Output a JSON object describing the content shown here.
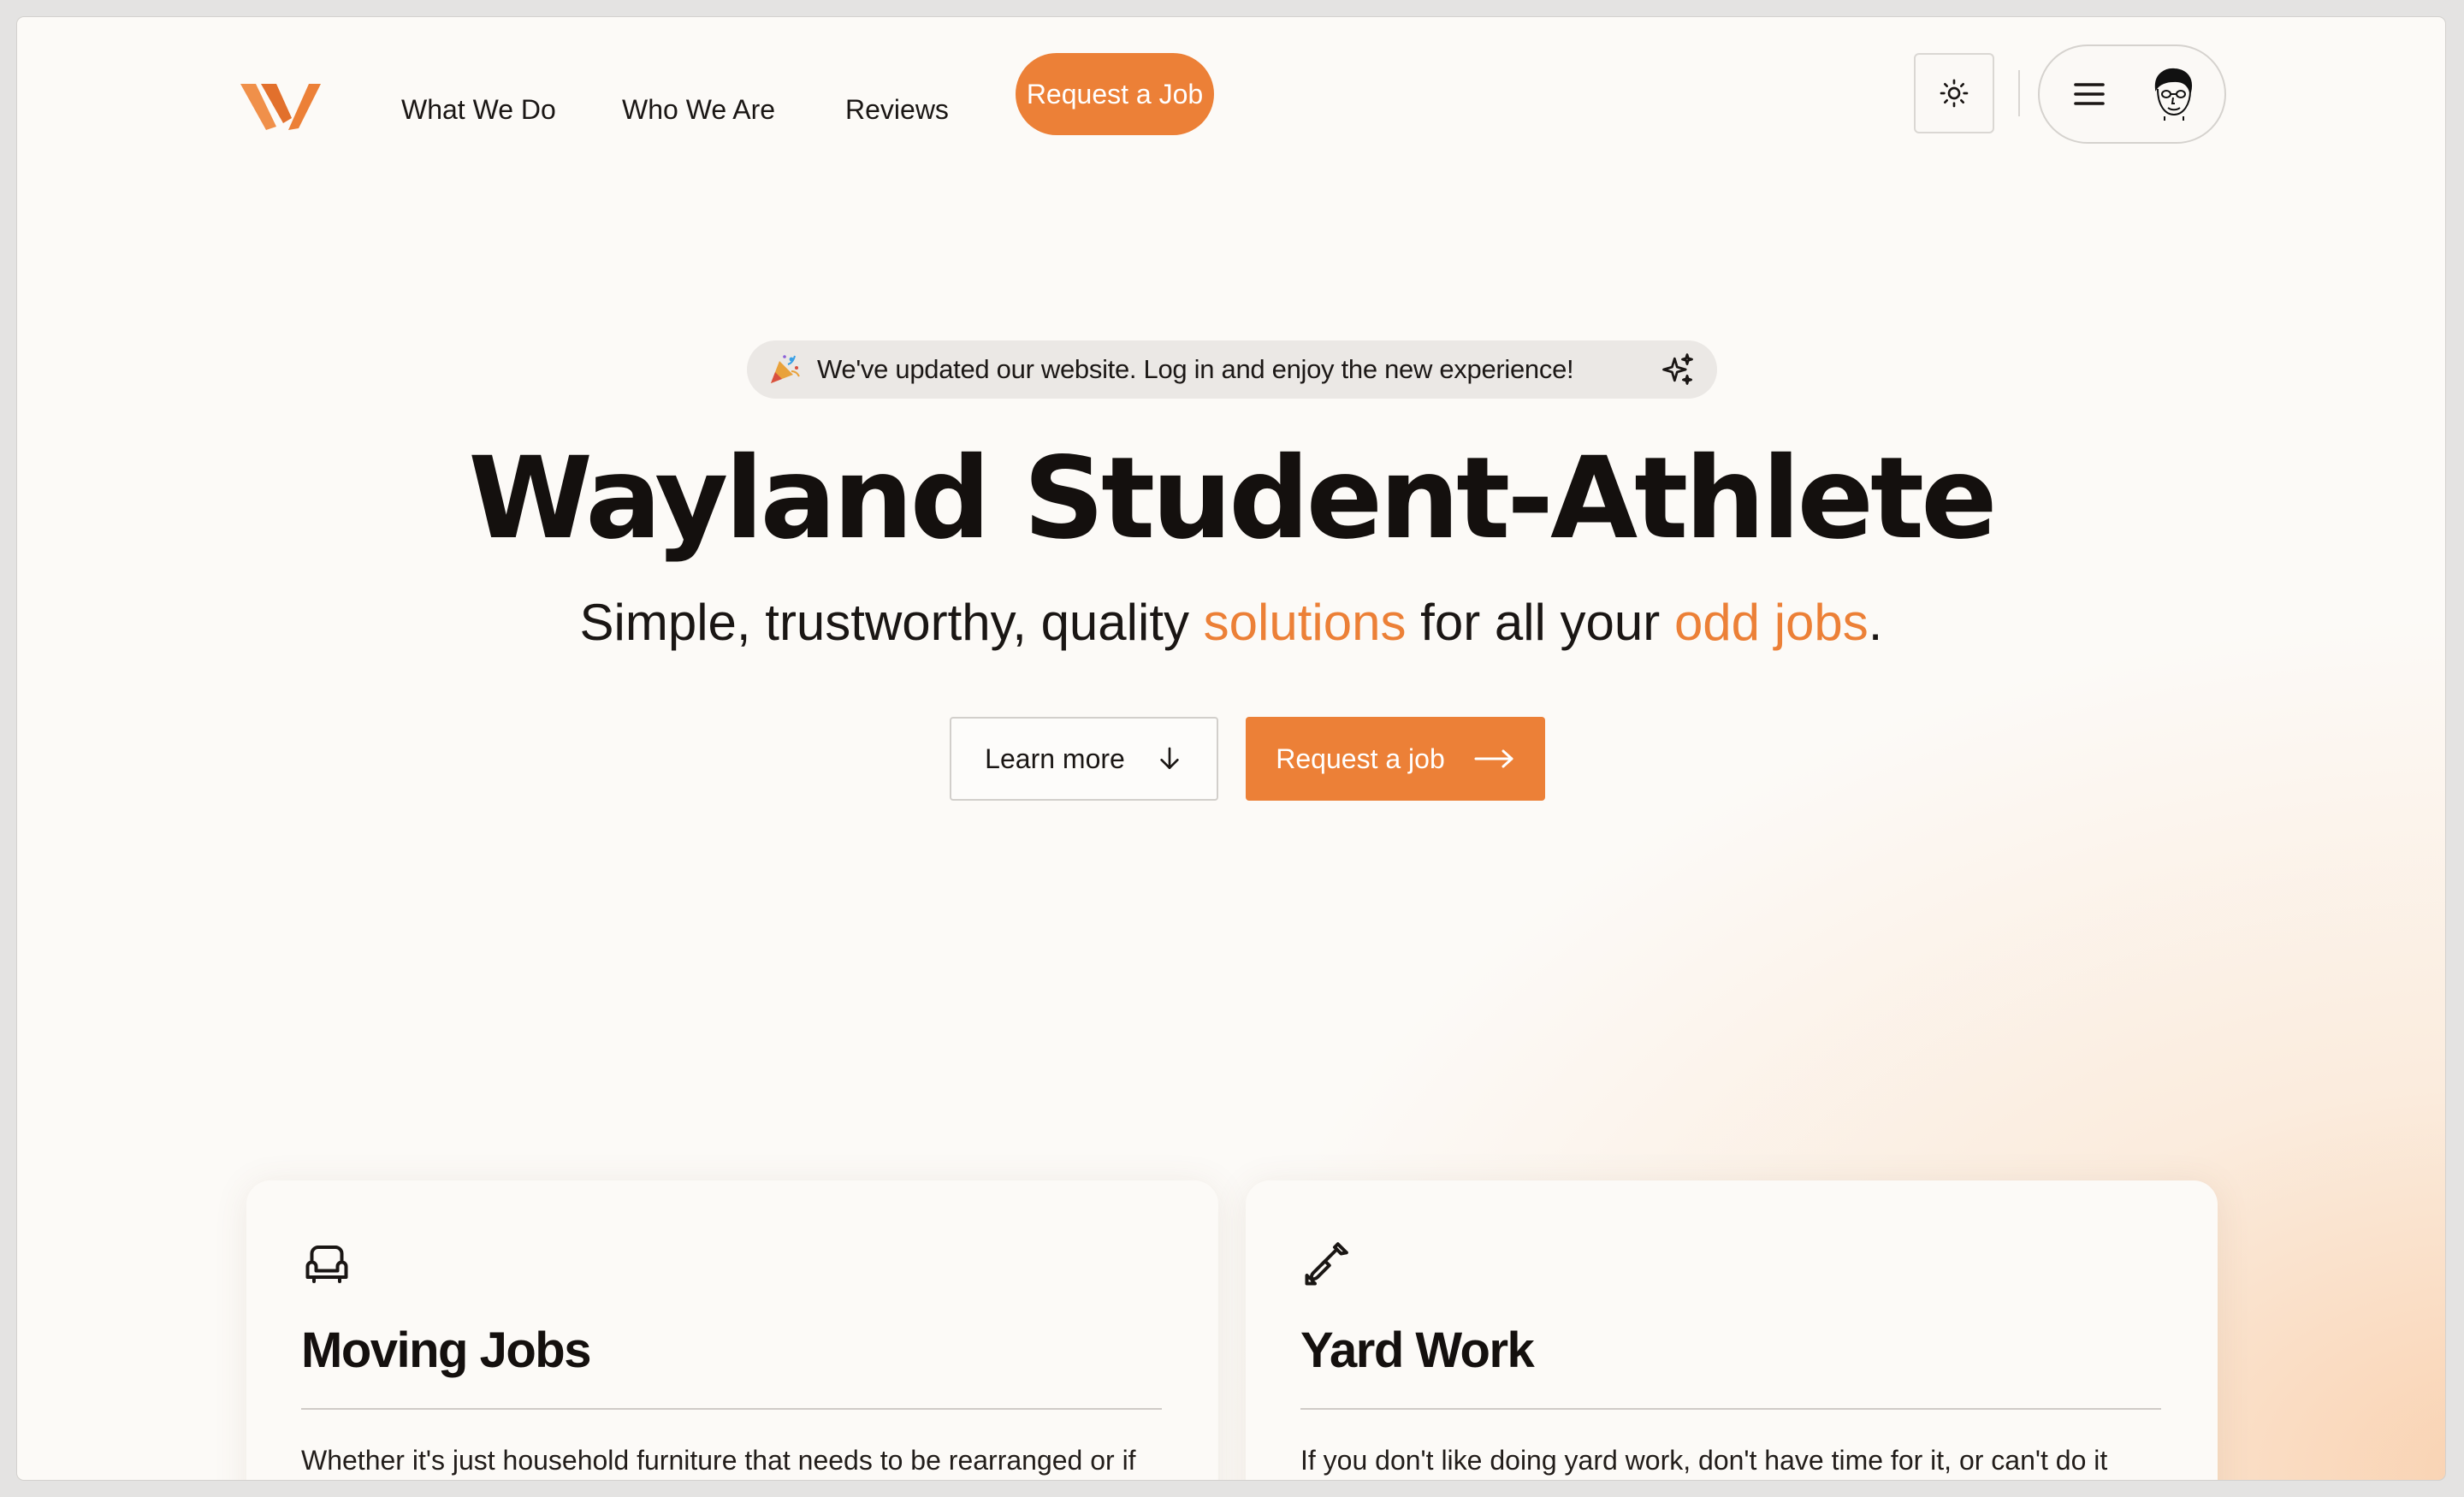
{
  "nav": {
    "links": [
      "What We Do",
      "Who We Are",
      "Reviews"
    ],
    "cta": "Request a Job",
    "theme_icon": "sun-icon",
    "menu_icon": "hamburger-menu-icon",
    "avatar_icon": "user-avatar-face-icon"
  },
  "banner": {
    "text": "We've updated our website. Log in and enjoy the new experience!",
    "left_icon": "party-popper-icon",
    "right_icon": "sparkles-icon"
  },
  "hero": {
    "title": "Wayland Student-Athlete",
    "subtitle": {
      "part1": "Simple, trustworthy, quality ",
      "accent1": "solutions",
      "part2": " for all your ",
      "accent2": "odd jobs",
      "part3": "."
    },
    "learn_more": "Learn more",
    "request": "Request a job"
  },
  "services": [
    {
      "icon": "armchair-icon",
      "title": "Moving Jobs",
      "text": "Whether it's just household furniture that needs to be rearranged or if your planning on moving, we've done it countless times."
    },
    {
      "icon": "shovel-icon",
      "title": "Yard Work",
      "text": "If you don't like doing yard work, don't have time for it, or can't do it yourself, we would be glad to help you out. As student-athletes"
    }
  ],
  "colors": {
    "accent": "#ec8037",
    "background": "#fcfaf7",
    "text": "#14100e"
  }
}
